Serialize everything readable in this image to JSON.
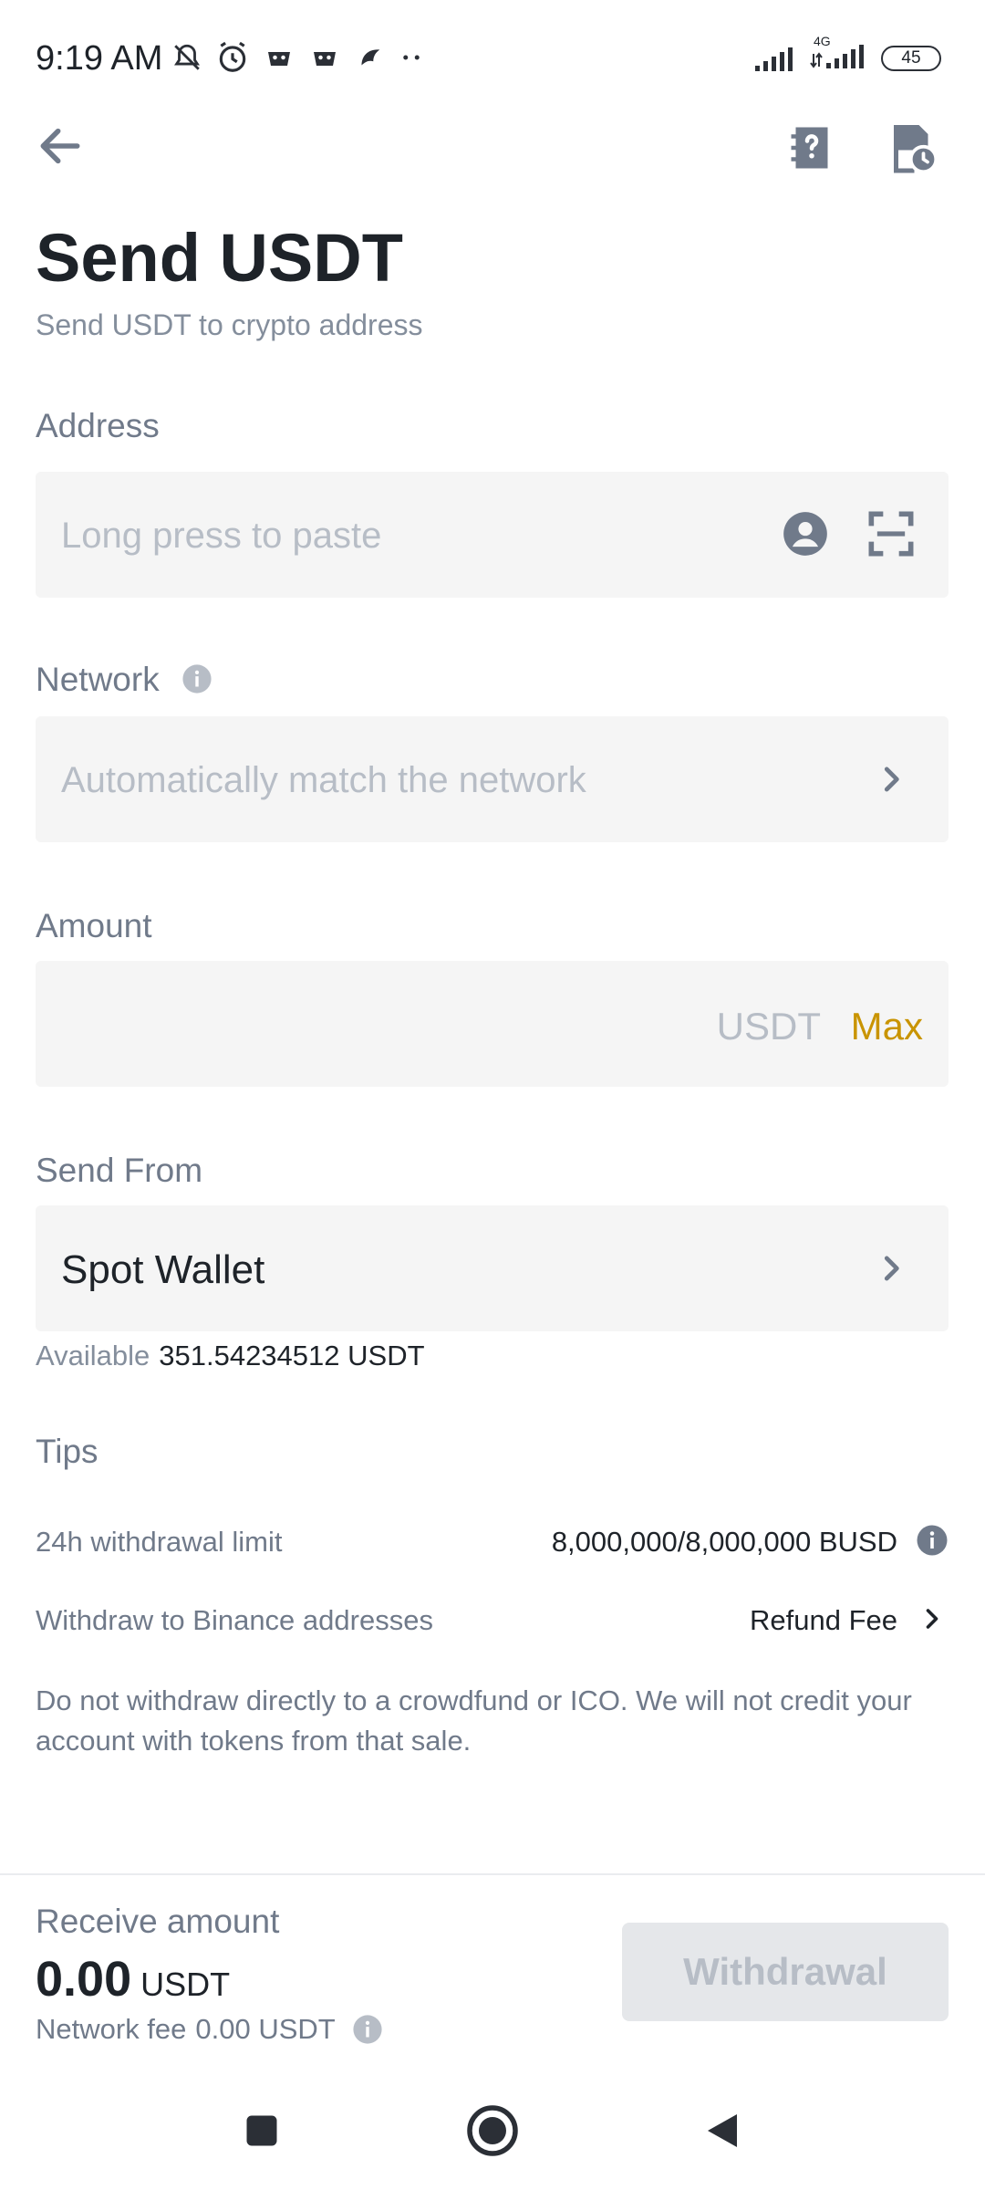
{
  "status_bar": {
    "time": "9:19 AM",
    "network": "4G",
    "battery": "45"
  },
  "header": {
    "title": "Send USDT",
    "subtitle": "Send USDT to crypto address"
  },
  "address": {
    "label": "Address",
    "placeholder": "Long press to paste"
  },
  "network": {
    "label": "Network",
    "placeholder": "Automatically match the network"
  },
  "amount": {
    "label": "Amount",
    "unit": "USDT",
    "max_label": "Max"
  },
  "send_from": {
    "label": "Send From",
    "wallet": "Spot Wallet",
    "available_label": "Available",
    "available_value": "351.54234512 USDT"
  },
  "tips": {
    "title": "Tips",
    "limit_label": "24h withdrawal limit",
    "limit_value": "8,000,000/8,000,000 BUSD",
    "binance_label": "Withdraw to Binance addresses",
    "binance_value": "Refund Fee",
    "disclaimer": "Do not withdraw directly to a crowdfund or ICO. We will not credit your account with tokens from that sale."
  },
  "footer": {
    "receive_label": "Receive amount",
    "receive_value": "0.00",
    "receive_unit": "USDT",
    "fee_label": "Network fee",
    "fee_value": "0.00 USDT",
    "withdraw_label": "Withdrawal"
  },
  "colors": {
    "accent": "#c99400",
    "text_primary": "#1e2329",
    "text_secondary": "#707a8a",
    "field_bg": "#f5f5f5",
    "disabled_bg": "#e5e7ea"
  },
  "icons": {
    "back": "arrow-left-icon",
    "faq": "help-document-icon",
    "history": "history-icon",
    "contact": "contact-icon",
    "scan": "scan-icon",
    "info": "info-icon",
    "chevron": "chevron-right-icon"
  }
}
